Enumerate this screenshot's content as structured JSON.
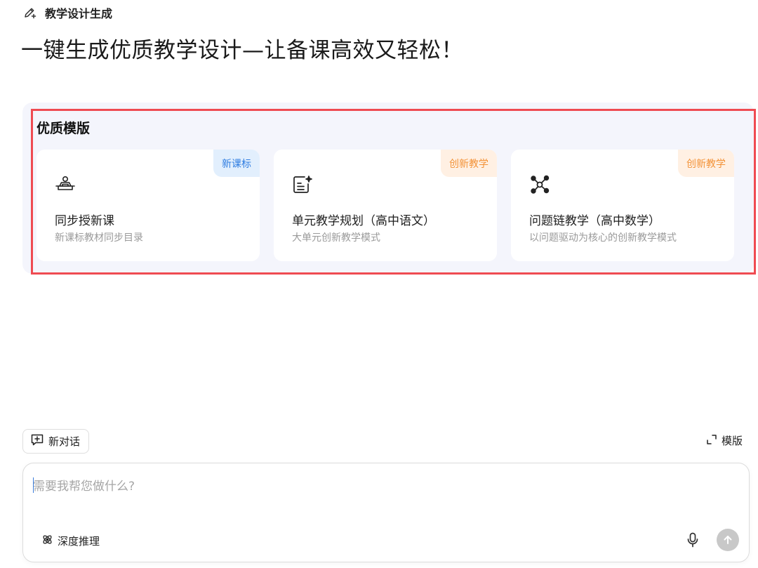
{
  "app": {
    "title": "教学设计生成",
    "icon": "edit-sparkle-icon"
  },
  "headline": "一键生成优质教学设计—让备课高效又轻松！",
  "templates": {
    "heading": "优质模版",
    "cards": [
      {
        "icon": "lesson-tray-icon",
        "badge": "新课标",
        "badge_color": "#2f7de1",
        "title": "同步授新课",
        "desc": "新课标教材同步目录"
      },
      {
        "icon": "document-sparkle-icon",
        "badge": "创新教学",
        "badge_color": "#f39237",
        "title": "单元教学规划（高中语文）",
        "desc": "大单元创新教学模式"
      },
      {
        "icon": "network-nodes-icon",
        "badge": "创新教学",
        "badge_color": "#f39237",
        "title": "问题链教学（高中数学）",
        "desc": "以问题驱动为核心的创新教学模式"
      }
    ]
  },
  "actions": {
    "new_chat": "新对话",
    "templates": "模版"
  },
  "composer": {
    "placeholder": "需要我帮您做什么?",
    "deep_think": "深度推理"
  },
  "colors": {
    "highlight_border": "#ef4b52",
    "section_bg": "#f4f5fc",
    "send_button": "#c8c8c8"
  }
}
